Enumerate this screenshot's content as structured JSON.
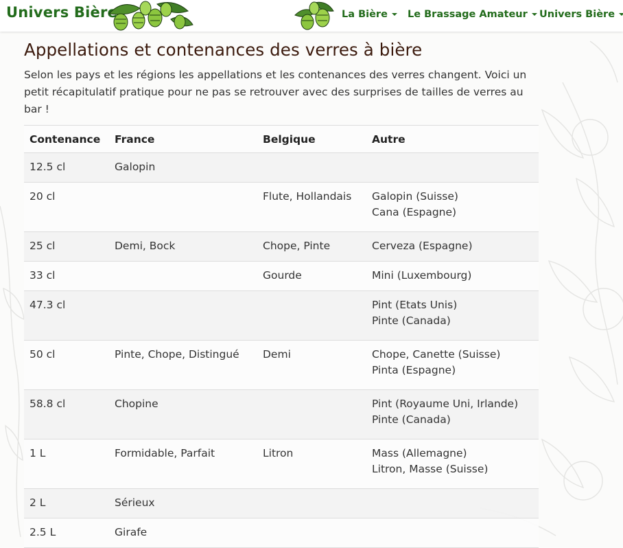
{
  "colors": {
    "brand": "#236c1c",
    "title": "#3b1a0d"
  },
  "navbar": {
    "brand": "Univers Bière",
    "items": [
      {
        "label": "La Bière"
      },
      {
        "label": "Le Brassage Amateur"
      },
      {
        "label": "Univers Bière"
      }
    ]
  },
  "page": {
    "title": "Appellations et contenances des verres à bière",
    "intro": "Selon les pays et les régions les appellations et les contenances des verres changent. Voici un petit récapitulatif pratique pour ne pas se retrouver avec des surprises de tailles de verres au bar !"
  },
  "table": {
    "headers": [
      "Contenance",
      "France",
      "Belgique",
      "Autre"
    ],
    "rows": [
      {
        "contenance": "12.5 cl",
        "france": "Galopin",
        "belgique": "",
        "autre": []
      },
      {
        "contenance": "20 cl",
        "france": "",
        "belgique": "Flute, Hollandais",
        "autre": [
          "Galopin (Suisse)",
          "Cana (Espagne)"
        ]
      },
      {
        "contenance": "25 cl",
        "france": "Demi, Bock",
        "belgique": "Chope, Pinte",
        "autre": [
          "Cerveza (Espagne)"
        ]
      },
      {
        "contenance": "33 cl",
        "france": "",
        "belgique": "Gourde",
        "autre": [
          "Mini (Luxembourg)"
        ]
      },
      {
        "contenance": "47.3 cl",
        "france": "",
        "belgique": "",
        "autre": [
          "Pint (Etats Unis)",
          "Pinte (Canada)"
        ]
      },
      {
        "contenance": "50 cl",
        "france": "Pinte, Chope, Distingué",
        "belgique": "Demi",
        "autre": [
          "Chope, Canette (Suisse)",
          "Pinta (Espagne)"
        ]
      },
      {
        "contenance": "58.8 cl",
        "france": "Chopine",
        "belgique": "",
        "autre": [
          "Pint (Royaume Uni, Irlande)",
          "Pinte (Canada)"
        ]
      },
      {
        "contenance": "1 L",
        "france": "Formidable, Parfait",
        "belgique": "Litron",
        "autre": [
          "Mass (Allemagne)",
          "Litron, Masse (Suisse)"
        ]
      },
      {
        "contenance": "2 L",
        "france": "Sérieux",
        "belgique": "",
        "autre": []
      },
      {
        "contenance": "2.5 L",
        "france": "Girafe",
        "belgique": "",
        "autre": []
      }
    ]
  }
}
